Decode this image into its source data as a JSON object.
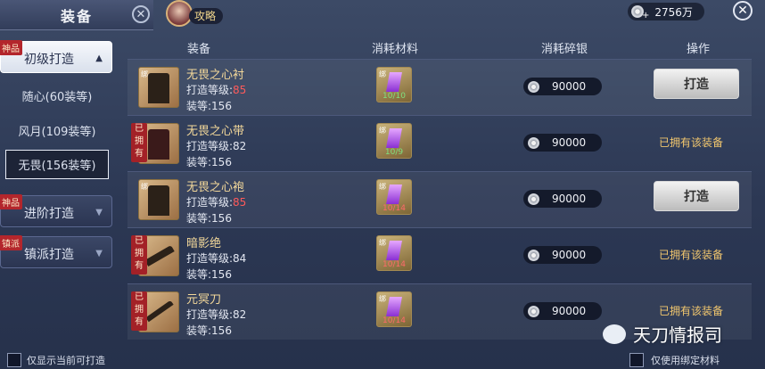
{
  "header": {
    "title": "装备",
    "guide_label": "攻略",
    "silver_amount": "2756万"
  },
  "menu": {
    "categories": [
      {
        "tag": "神品",
        "label": "初级打造",
        "expanded": true
      },
      {
        "tag": "神品",
        "label": "进阶打造",
        "expanded": false
      },
      {
        "tag": "镇派",
        "label": "镇派打造",
        "expanded": false
      }
    ],
    "sub_items": [
      "随心(60装等)",
      "风月(109装等)",
      "无畏(156装等)"
    ],
    "selected_sub": "无畏(156装等)"
  },
  "table": {
    "headers": [
      "装备",
      "消耗材料",
      "消耗碎银",
      "操作"
    ],
    "rows": [
      {
        "name": "无畏之心衬",
        "level_label": "打造等级:",
        "level": "85",
        "level_red": true,
        "grade_label": "装等:",
        "grade": "156",
        "owned_tag": "",
        "material_count": "10/10",
        "cost": "90000",
        "action": "打造",
        "bind": "绑"
      },
      {
        "name": "无畏之心带",
        "level_label": "打造等级:",
        "level": "82",
        "level_red": false,
        "grade_label": "装等:",
        "grade": "156",
        "owned_tag": "已拥有",
        "material_count": "10/9",
        "cost": "90000",
        "action": "已拥有该装备",
        "bind": "绑"
      },
      {
        "name": "无畏之心袍",
        "level_label": "打造等级:",
        "level": "85",
        "level_red": true,
        "grade_label": "装等:",
        "grade": "156",
        "owned_tag": "",
        "material_count": "10/14",
        "cost": "90000",
        "action": "打造",
        "bind": "绑"
      },
      {
        "name": "暗影绝",
        "level_label": "打造等级:",
        "level": "84",
        "level_red": false,
        "grade_label": "装等:",
        "grade": "156",
        "owned_tag": "已拥有",
        "material_count": "10/14",
        "cost": "90000",
        "action": "已拥有该装备",
        "bind": "绑"
      },
      {
        "name": "元冥刀",
        "level_label": "打造等级:",
        "level": "82",
        "level_red": false,
        "grade_label": "装等:",
        "grade": "156",
        "owned_tag": "已拥有",
        "material_count": "10/14",
        "cost": "90000",
        "action": "已拥有该装备",
        "bind": "绑"
      }
    ]
  },
  "footer": {
    "left_checkbox": "仅显示当前可打造",
    "right_checkbox": "仅使用绑定材料",
    "watermark": "天刀情报司"
  }
}
